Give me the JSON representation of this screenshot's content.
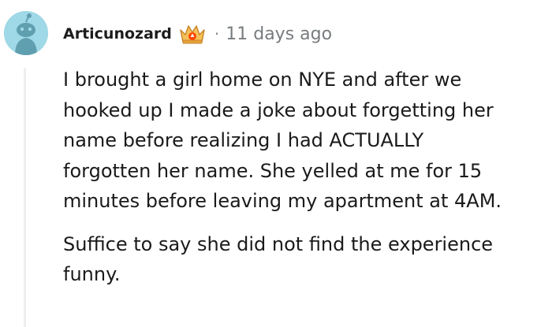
{
  "comment": {
    "author": "Articunozard",
    "separator": "·",
    "timestamp": "11 days ago",
    "avatar_icon": "snoo-avatar-icon",
    "badge_icon": "crown-badge-icon",
    "colors": {
      "avatar_bg": "#9fd8e6",
      "avatar_figure": "#5f9fb0",
      "text": "#1a1a1b",
      "meta": "#787c7e",
      "thread_line": "#edeff1",
      "badge_gold": "#e8a33b",
      "badge_orange": "#ff4500"
    },
    "body": {
      "paragraphs": [
        "I brought a girl home on NYE and after we\nhooked up I made a joke about forgetting her\nname before realizing I had ACTUALLY\nforgotten her name. She yelled at me for 15\nminutes before leaving my apartment at 4AM.",
        "Suffice to say she did not find the experience\nfunny."
      ]
    }
  }
}
